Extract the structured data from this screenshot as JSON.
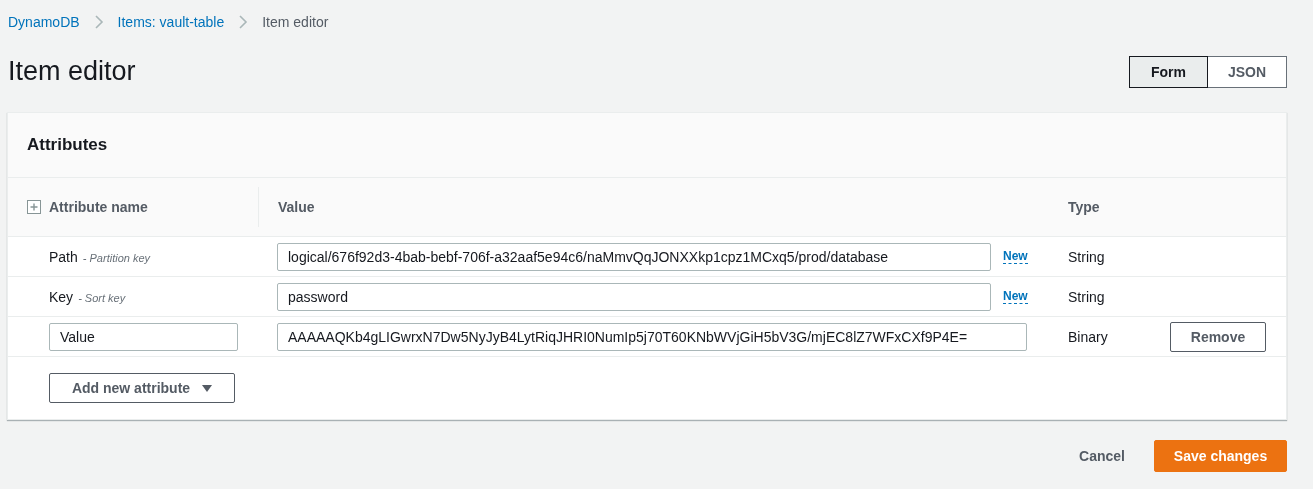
{
  "breadcrumb": [
    {
      "label": "DynamoDB",
      "current": false
    },
    {
      "label": "Items: vault-table",
      "current": false
    },
    {
      "label": "Item editor",
      "current": true
    }
  ],
  "page_title": "Item editor",
  "view_toggle": [
    {
      "label": "Form",
      "selected": true
    },
    {
      "label": "JSON",
      "selected": false
    }
  ],
  "attributes_panel": {
    "title": "Attributes",
    "columns": [
      "Attribute name",
      "Value",
      "Type"
    ],
    "rows": [
      {
        "kind": "key",
        "name": "Path",
        "key_type": "- Partition key",
        "value": "logical/676f92d3-4bab-bebf-706f-a32aaf5e94c6/naMmvQqJONXXkp1cpz1MCxq5/prod/database",
        "badge": "New",
        "type": "String"
      },
      {
        "kind": "key",
        "name": "Key",
        "key_type": "- Sort key",
        "value": "password",
        "badge": "New",
        "type": "String"
      },
      {
        "kind": "custom",
        "name": "Value",
        "value": "AAAAAQKb4gLIGwrxN7Dw5NyJyB4LytRiqJHRI0NumIp5j70T60KNbWVjGiH5bV3G/mjEC8lZ7WFxCXf9P4E=",
        "type": "Binary",
        "action": "Remove"
      }
    ],
    "add_button": "Add new attribute"
  },
  "footer": {
    "cancel": "Cancel",
    "save": "Save changes"
  }
}
